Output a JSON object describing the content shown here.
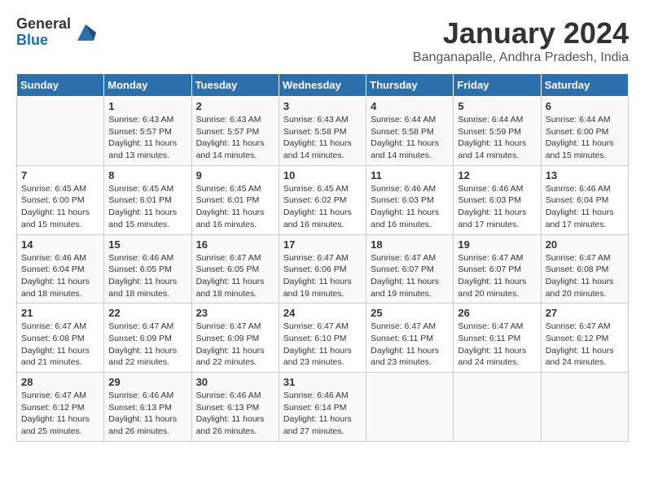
{
  "header": {
    "logo_general": "General",
    "logo_blue": "Blue",
    "month_year": "January 2024",
    "location": "Banganapalle, Andhra Pradesh, India"
  },
  "days_of_week": [
    "Sunday",
    "Monday",
    "Tuesday",
    "Wednesday",
    "Thursday",
    "Friday",
    "Saturday"
  ],
  "weeks": [
    [
      {
        "day": "",
        "sunrise": "",
        "sunset": "",
        "daylight": ""
      },
      {
        "day": "1",
        "sunrise": "Sunrise: 6:43 AM",
        "sunset": "Sunset: 5:57 PM",
        "daylight": "Daylight: 11 hours and 13 minutes."
      },
      {
        "day": "2",
        "sunrise": "Sunrise: 6:43 AM",
        "sunset": "Sunset: 5:57 PM",
        "daylight": "Daylight: 11 hours and 14 minutes."
      },
      {
        "day": "3",
        "sunrise": "Sunrise: 6:43 AM",
        "sunset": "Sunset: 5:58 PM",
        "daylight": "Daylight: 11 hours and 14 minutes."
      },
      {
        "day": "4",
        "sunrise": "Sunrise: 6:44 AM",
        "sunset": "Sunset: 5:58 PM",
        "daylight": "Daylight: 11 hours and 14 minutes."
      },
      {
        "day": "5",
        "sunrise": "Sunrise: 6:44 AM",
        "sunset": "Sunset: 5:59 PM",
        "daylight": "Daylight: 11 hours and 14 minutes."
      },
      {
        "day": "6",
        "sunrise": "Sunrise: 6:44 AM",
        "sunset": "Sunset: 6:00 PM",
        "daylight": "Daylight: 11 hours and 15 minutes."
      }
    ],
    [
      {
        "day": "7",
        "sunrise": "Sunrise: 6:45 AM",
        "sunset": "Sunset: 6:00 PM",
        "daylight": "Daylight: 11 hours and 15 minutes."
      },
      {
        "day": "8",
        "sunrise": "Sunrise: 6:45 AM",
        "sunset": "Sunset: 6:01 PM",
        "daylight": "Daylight: 11 hours and 15 minutes."
      },
      {
        "day": "9",
        "sunrise": "Sunrise: 6:45 AM",
        "sunset": "Sunset: 6:01 PM",
        "daylight": "Daylight: 11 hours and 16 minutes."
      },
      {
        "day": "10",
        "sunrise": "Sunrise: 6:45 AM",
        "sunset": "Sunset: 6:02 PM",
        "daylight": "Daylight: 11 hours and 16 minutes."
      },
      {
        "day": "11",
        "sunrise": "Sunrise: 6:46 AM",
        "sunset": "Sunset: 6:03 PM",
        "daylight": "Daylight: 11 hours and 16 minutes."
      },
      {
        "day": "12",
        "sunrise": "Sunrise: 6:46 AM",
        "sunset": "Sunset: 6:03 PM",
        "daylight": "Daylight: 11 hours and 17 minutes."
      },
      {
        "day": "13",
        "sunrise": "Sunrise: 6:46 AM",
        "sunset": "Sunset: 6:04 PM",
        "daylight": "Daylight: 11 hours and 17 minutes."
      }
    ],
    [
      {
        "day": "14",
        "sunrise": "Sunrise: 6:46 AM",
        "sunset": "Sunset: 6:04 PM",
        "daylight": "Daylight: 11 hours and 18 minutes."
      },
      {
        "day": "15",
        "sunrise": "Sunrise: 6:46 AM",
        "sunset": "Sunset: 6:05 PM",
        "daylight": "Daylight: 11 hours and 18 minutes."
      },
      {
        "day": "16",
        "sunrise": "Sunrise: 6:47 AM",
        "sunset": "Sunset: 6:05 PM",
        "daylight": "Daylight: 11 hours and 18 minutes."
      },
      {
        "day": "17",
        "sunrise": "Sunrise: 6:47 AM",
        "sunset": "Sunset: 6:06 PM",
        "daylight": "Daylight: 11 hours and 19 minutes."
      },
      {
        "day": "18",
        "sunrise": "Sunrise: 6:47 AM",
        "sunset": "Sunset: 6:07 PM",
        "daylight": "Daylight: 11 hours and 19 minutes."
      },
      {
        "day": "19",
        "sunrise": "Sunrise: 6:47 AM",
        "sunset": "Sunset: 6:07 PM",
        "daylight": "Daylight: 11 hours and 20 minutes."
      },
      {
        "day": "20",
        "sunrise": "Sunrise: 6:47 AM",
        "sunset": "Sunset: 6:08 PM",
        "daylight": "Daylight: 11 hours and 20 minutes."
      }
    ],
    [
      {
        "day": "21",
        "sunrise": "Sunrise: 6:47 AM",
        "sunset": "Sunset: 6:08 PM",
        "daylight": "Daylight: 11 hours and 21 minutes."
      },
      {
        "day": "22",
        "sunrise": "Sunrise: 6:47 AM",
        "sunset": "Sunset: 6:09 PM",
        "daylight": "Daylight: 11 hours and 22 minutes."
      },
      {
        "day": "23",
        "sunrise": "Sunrise: 6:47 AM",
        "sunset": "Sunset: 6:09 PM",
        "daylight": "Daylight: 11 hours and 22 minutes."
      },
      {
        "day": "24",
        "sunrise": "Sunrise: 6:47 AM",
        "sunset": "Sunset: 6:10 PM",
        "daylight": "Daylight: 11 hours and 23 minutes."
      },
      {
        "day": "25",
        "sunrise": "Sunrise: 6:47 AM",
        "sunset": "Sunset: 6:11 PM",
        "daylight": "Daylight: 11 hours and 23 minutes."
      },
      {
        "day": "26",
        "sunrise": "Sunrise: 6:47 AM",
        "sunset": "Sunset: 6:11 PM",
        "daylight": "Daylight: 11 hours and 24 minutes."
      },
      {
        "day": "27",
        "sunrise": "Sunrise: 6:47 AM",
        "sunset": "Sunset: 6:12 PM",
        "daylight": "Daylight: 11 hours and 24 minutes."
      }
    ],
    [
      {
        "day": "28",
        "sunrise": "Sunrise: 6:47 AM",
        "sunset": "Sunset: 6:12 PM",
        "daylight": "Daylight: 11 hours and 25 minutes."
      },
      {
        "day": "29",
        "sunrise": "Sunrise: 6:46 AM",
        "sunset": "Sunset: 6:13 PM",
        "daylight": "Daylight: 11 hours and 26 minutes."
      },
      {
        "day": "30",
        "sunrise": "Sunrise: 6:46 AM",
        "sunset": "Sunset: 6:13 PM",
        "daylight": "Daylight: 11 hours and 26 minutes."
      },
      {
        "day": "31",
        "sunrise": "Sunrise: 6:46 AM",
        "sunset": "Sunset: 6:14 PM",
        "daylight": "Daylight: 11 hours and 27 minutes."
      },
      {
        "day": "",
        "sunrise": "",
        "sunset": "",
        "daylight": ""
      },
      {
        "day": "",
        "sunrise": "",
        "sunset": "",
        "daylight": ""
      },
      {
        "day": "",
        "sunrise": "",
        "sunset": "",
        "daylight": ""
      }
    ]
  ]
}
